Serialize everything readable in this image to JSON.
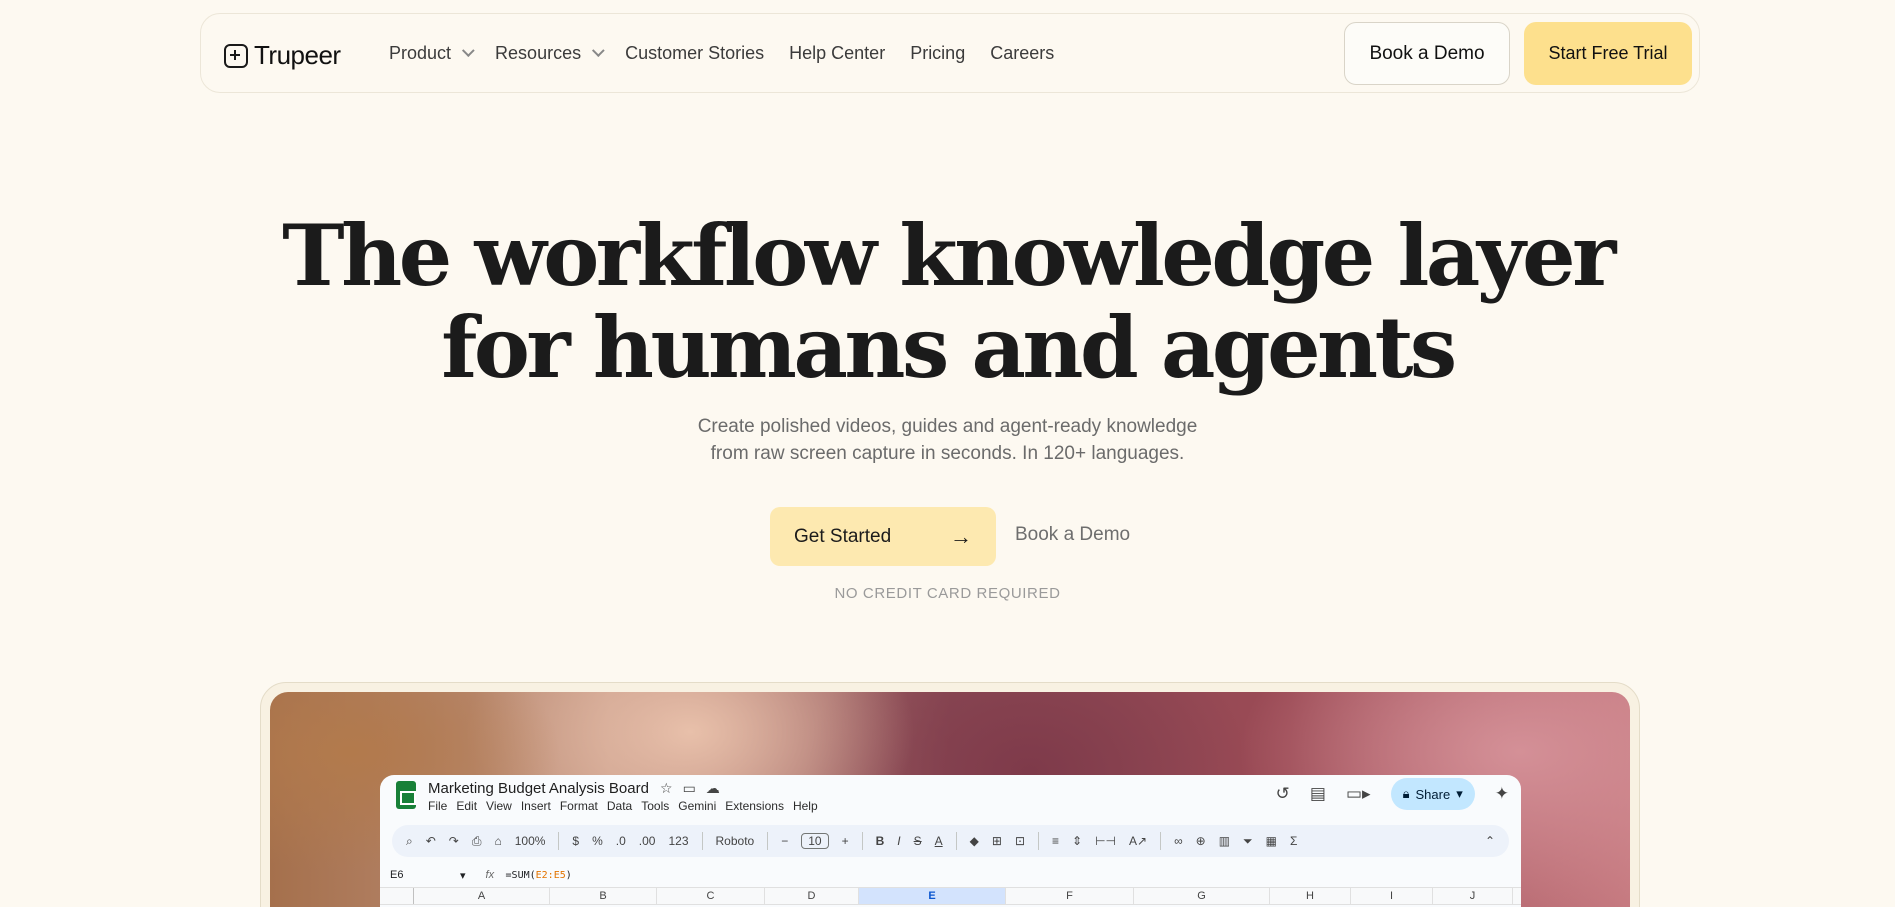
{
  "nav": {
    "logo_text": "Trupeer",
    "items": [
      {
        "label": "Product",
        "dropdown": true
      },
      {
        "label": "Resources",
        "dropdown": true
      },
      {
        "label": "Customer Stories",
        "dropdown": false
      },
      {
        "label": "Help Center",
        "dropdown": false
      },
      {
        "label": "Pricing",
        "dropdown": false
      },
      {
        "label": "Careers",
        "dropdown": false
      }
    ],
    "book_demo": "Book a Demo",
    "start_trial": "Start Free Trial"
  },
  "hero": {
    "headline_line1": "The workflow knowledge layer",
    "headline_line2": "for humans and agents",
    "sub_line1": "Create polished videos, guides and agent-ready knowledge",
    "sub_line2": "from raw screen capture in seconds. In 120+ languages.",
    "cta_primary": "Get Started",
    "cta_secondary": "Book a Demo",
    "note": "NO CREDIT CARD REQUIRED"
  },
  "sheet": {
    "title": "Marketing Budget Analysis Board",
    "menu": [
      "File",
      "Edit",
      "View",
      "Insert",
      "Format",
      "Data",
      "Tools",
      "Gemini",
      "Extensions",
      "Help"
    ],
    "share_label": "Share",
    "zoom": "100%",
    "currency": "$",
    "percent": "%",
    "dec_less": ".0",
    "dec_more": ".00",
    "num_format": "123",
    "font": "Roboto",
    "font_size": "10",
    "cell_ref": "E6",
    "formula_prefix": "=SUM(",
    "formula_range": "E2:E5",
    "formula_suffix": ")",
    "columns": [
      "A",
      "B",
      "C",
      "D",
      "E",
      "F",
      "G",
      "H",
      "I",
      "J"
    ],
    "selected_column": "E"
  },
  "colors": {
    "background": "#fdf9f1",
    "accent_yellow": "#fde08d",
    "cta_yellow": "#fde9b0",
    "sheets_green": "#188038",
    "share_blue": "#c2e7ff"
  }
}
